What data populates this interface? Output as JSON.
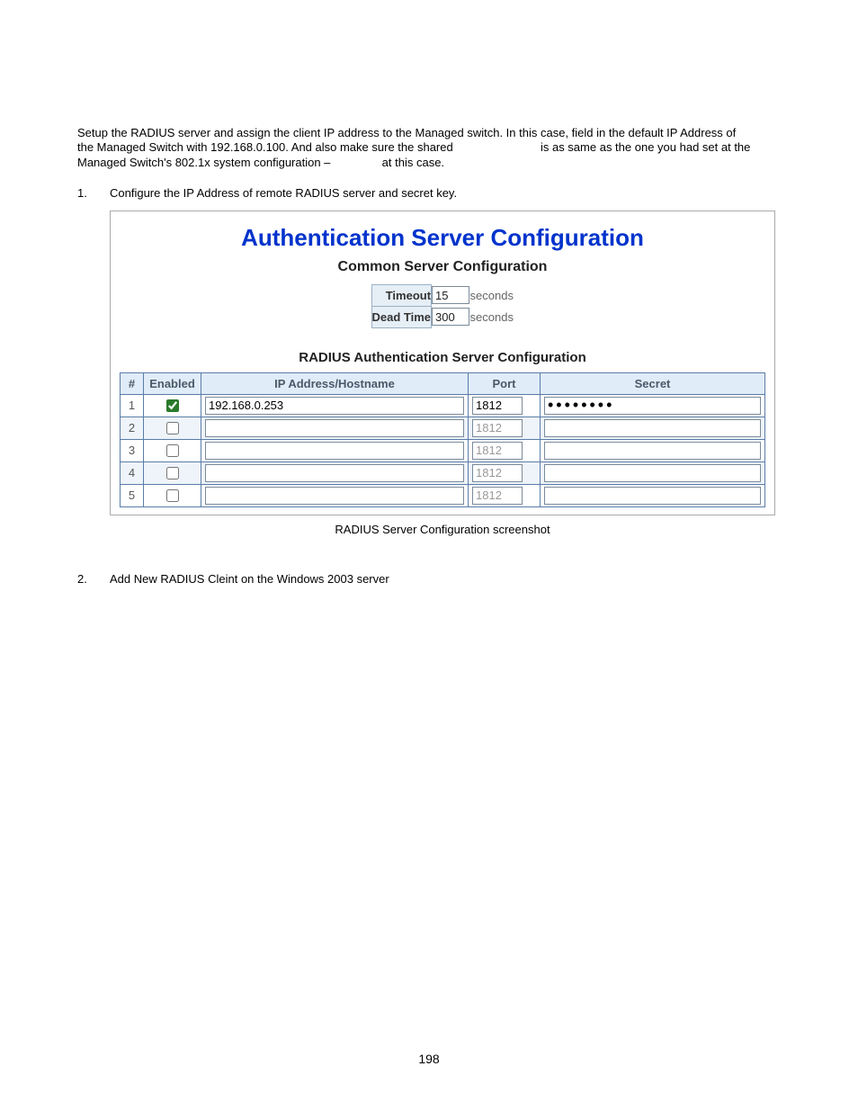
{
  "intro": {
    "line1a": "Setup the RADIUS server and assign the client IP address to the Managed switch. In this case, field in the default IP Address of",
    "line2a": "the Managed Switch with 192.168.0.100. And also make sure the shared",
    "line2b": "is as same as the one you had set at the",
    "line3a": "Managed Switch's 802.1x system configuration –",
    "line3b": "at this case."
  },
  "step1": {
    "num": "1.",
    "text": "Configure the IP Address of remote RADIUS server and secret key."
  },
  "config": {
    "title": "Authentication Server Configuration",
    "sub": "Common Server Configuration",
    "common": {
      "timeout_label": "Timeout",
      "timeout_value": "15",
      "timeout_unit": "seconds",
      "dead_label": "Dead Time",
      "dead_value": "300",
      "dead_unit": "seconds"
    },
    "radius_sub": "RADIUS Authentication Server Configuration",
    "headers": {
      "idx": "#",
      "enabled": "Enabled",
      "ip": "IP Address/Hostname",
      "port": "Port",
      "secret": "Secret"
    },
    "rows": [
      {
        "idx": "1",
        "enabled": true,
        "ip": "192.168.0.253",
        "port": "1812",
        "secret": "••••••••",
        "active": true
      },
      {
        "idx": "2",
        "enabled": false,
        "ip": "",
        "port": "1812",
        "secret": "",
        "active": false
      },
      {
        "idx": "3",
        "enabled": false,
        "ip": "",
        "port": "1812",
        "secret": "",
        "active": false
      },
      {
        "idx": "4",
        "enabled": false,
        "ip": "",
        "port": "1812",
        "secret": "",
        "active": false
      },
      {
        "idx": "5",
        "enabled": false,
        "ip": "",
        "port": "1812",
        "secret": "",
        "active": false
      }
    ]
  },
  "caption": "RADIUS Server Configuration screenshot",
  "step2": {
    "num": "2.",
    "text": "Add New RADIUS Cleint on the Windows 2003 server"
  },
  "page_number": "198"
}
